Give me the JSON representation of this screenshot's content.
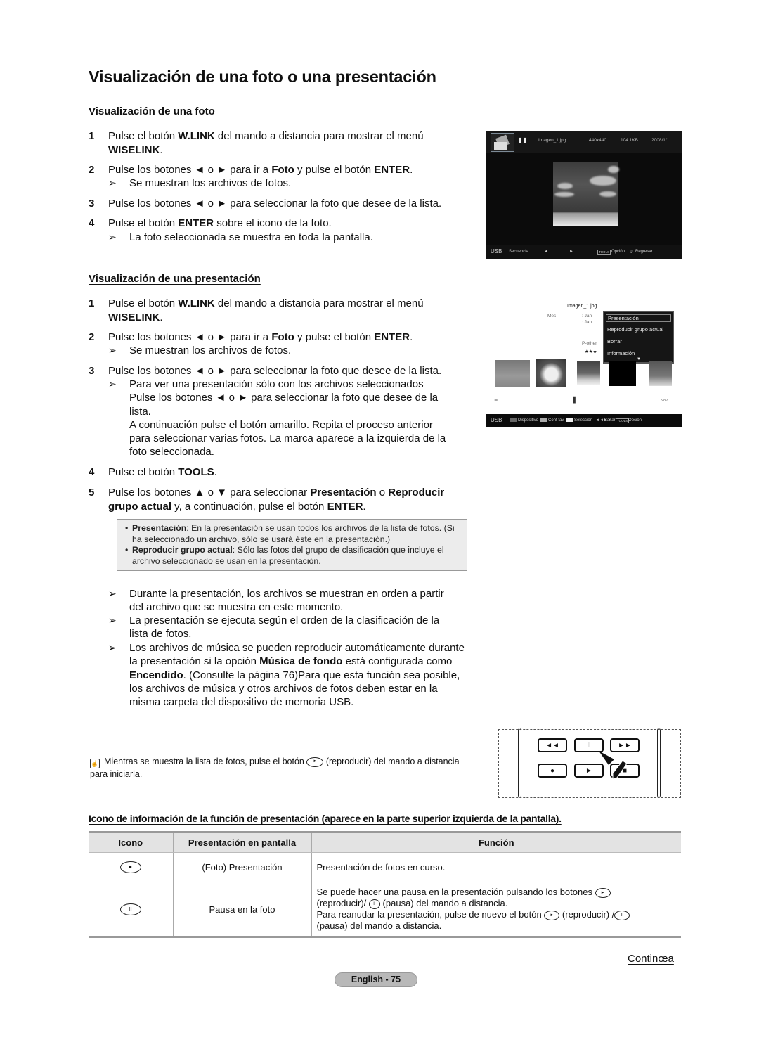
{
  "page": {
    "title": "Visualización de una foto o una presentación",
    "continue_label": "Continœa",
    "page_badge": "English - 75"
  },
  "section_photo": {
    "heading": "Visualización de una foto",
    "steps": [
      {
        "num": "1",
        "parts": [
          [
            "Pulse el botón ",
            false
          ],
          [
            "W.LINK",
            true
          ],
          [
            " del mando a distancia para mostrar el menú ",
            false
          ],
          [
            "WISELINK",
            true
          ],
          [
            ".",
            false
          ]
        ]
      },
      {
        "num": "2",
        "parts": [
          [
            "Pulse los botones ◄ o ► para ir a ",
            false
          ],
          [
            "Foto",
            true
          ],
          [
            " y pulse el botón ",
            false
          ],
          [
            "ENTER",
            true
          ],
          [
            ".",
            false
          ]
        ],
        "note": "Se muestran los archivos de fotos."
      },
      {
        "num": "3",
        "parts": [
          [
            "Pulse los botones ◄ o ► para seleccionar la foto que desee de la lista.",
            false
          ]
        ]
      },
      {
        "num": "4",
        "parts": [
          [
            "Pulse el botón ",
            false
          ],
          [
            "ENTER",
            true
          ],
          [
            " sobre el icono de la foto.",
            false
          ]
        ],
        "note": "La foto seleccionada se muestra en toda la pantalla."
      }
    ]
  },
  "section_slideshow": {
    "heading": "Visualización de una presentación",
    "steps": [
      {
        "num": "1",
        "parts": [
          [
            "Pulse el botón ",
            false
          ],
          [
            "W.LINK",
            true
          ],
          [
            " del mando a distancia para mostrar el menú ",
            false
          ],
          [
            "WISELINK",
            true
          ],
          [
            ".",
            false
          ]
        ]
      },
      {
        "num": "2",
        "parts": [
          [
            "Pulse los botones ◄ o ► para ir a ",
            false
          ],
          [
            "Foto",
            true
          ],
          [
            " y pulse el botón ",
            false
          ],
          [
            "ENTER",
            true
          ],
          [
            ".",
            false
          ]
        ],
        "note": "Se muestran los archivos de fotos."
      },
      {
        "num": "3",
        "parts": [
          [
            "Pulse los botones ◄ o ► para seleccionar la foto que desee de la lista.",
            false
          ]
        ],
        "note_lines": [
          "Para ver una presentación sólo con los archivos seleccionados",
          "Pulse los botones ◄ o ► para seleccionar la foto que desee de la lista.",
          "A continuación pulse el botón amarillo. Repita el proceso anterior para seleccionar varias fotos. La marca aparece a la izquierda de la foto seleccionada."
        ]
      },
      {
        "num": "4",
        "parts": [
          [
            "Pulse el botón ",
            false
          ],
          [
            "TOOLS",
            true
          ],
          [
            ".",
            false
          ]
        ]
      },
      {
        "num": "5",
        "parts": [
          [
            "Pulse los botones ▲ o ▼ para seleccionar ",
            false
          ],
          [
            "Presentación",
            true
          ],
          [
            " o ",
            false
          ],
          [
            "Reproducir grupo actual",
            true
          ],
          [
            " y, a continuación, pulse el botón ",
            false
          ],
          [
            "ENTER",
            true
          ],
          [
            ".",
            false
          ]
        ]
      }
    ],
    "info_box": [
      {
        "term": "Presentación",
        "text": ": En la presentación se usan todos los archivos de la lista de fotos. (Si ha seleccionado un archivo, sólo se usará éste en la presentación.)"
      },
      {
        "term": "Reproducir grupo actual",
        "text": ": Sólo las fotos del grupo de clasificación que incluye el archivo seleccionado se usan en la presentación."
      }
    ],
    "notes": [
      [
        [
          "Durante la presentación, los archivos se muestran en orden a partir del archivo que se muestra en este momento.",
          false
        ]
      ],
      [
        [
          "La presentación se ejecuta según el orden de la clasificación de la lista de fotos.",
          false
        ]
      ],
      [
        [
          "Los archivos de música se pueden reproducir automáticamente durante la presentación si la opción ",
          false
        ],
        [
          "Música de fondo",
          true
        ],
        [
          " está configurada como ",
          false
        ],
        [
          "Encendido",
          true
        ],
        [
          ". (Consulte la página 76)Para que esta función sea posible, los archivos de música y otros archivos de fotos deben estar en la misma carpeta del dispositivo de memoria USB.",
          false
        ]
      ]
    ]
  },
  "tip": {
    "before": "Mientras se muestra la lista de fotos, pulse el botón",
    "after": "(reproducir) del mando a distancia para iniciarla."
  },
  "tv_screen_1": {
    "file_name": "Imagen_1.jpg",
    "resolution": "440x440",
    "file_size": "104.1KB",
    "date": "2008/1/1",
    "bottom": {
      "source": "USB",
      "sequence": "Secuencia",
      "left": "◄",
      "right": "►",
      "tools": "TOOLS",
      "option": "Opción",
      "return": "Regresar"
    }
  },
  "tv_screen_2": {
    "file_name": "Imagen_1.jpg",
    "month_label": "Mes",
    "month_values": [
      ": Jan",
      ": Jan"
    ],
    "category": "P-other",
    "rating": "★★★",
    "menu_items": [
      "Presentación",
      "Reproducir grupo actual",
      "Borrar",
      "Información"
    ],
    "timeline_label": "Nov",
    "bottom": {
      "source": "USB",
      "device": "Dispositivo",
      "fav": "Conf fav",
      "select": "Selección",
      "skip": "Saltar",
      "tools": "TOOLS",
      "option": "Opción"
    }
  },
  "remote": {
    "buttons": [
      "◄◄",
      "II",
      "►►",
      "●",
      "►",
      "■"
    ]
  },
  "table": {
    "title": "Icono de información de la función de presentación (aparece en la parte superior izquierda de la pantalla).",
    "headers": [
      "Icono",
      "Presentación en pantalla",
      "Función"
    ],
    "rows": [
      {
        "icon": "►",
        "display": "(Foto) Presentación",
        "function_lines": [
          "Presentación de fotos en curso."
        ]
      },
      {
        "icon": "II",
        "display": "Pausa en la foto",
        "function_lines": [
          "Se puede hacer una pausa en la presentación pulsando los botones",
          "(reproducir)/",
          "(pausa) del mando a distancia.",
          "Para reanudar la presentación, pulse de nuevo el botón",
          "(reproducir) /",
          "(pausa) del mando a distancia."
        ]
      }
    ]
  }
}
